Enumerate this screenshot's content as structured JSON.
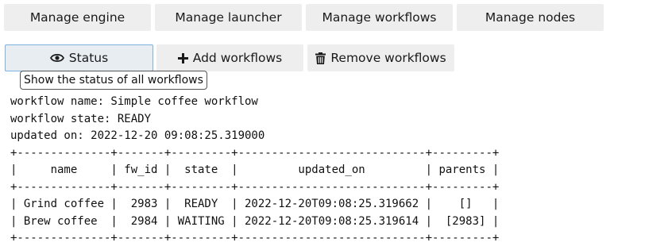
{
  "toolbar": {
    "manage_engine": "Manage engine",
    "manage_launcher": "Manage launcher",
    "manage_workflows": "Manage workflows",
    "manage_nodes": "Manage nodes"
  },
  "actions": {
    "status": {
      "label": "Status",
      "icon": "eye-icon"
    },
    "add_workflows": {
      "label": "Add workflows",
      "icon": "plus-icon"
    },
    "remove_workflows": {
      "label": "Remove workflows",
      "icon": "trash-icon"
    }
  },
  "tooltip": "Show the status of all workflows",
  "output": {
    "workflow_name_line": "workflow name: Simple coffee workflow",
    "workflow_state_line": "workflow state: READY",
    "updated_on_line": "updated on: 2022-12-20 09:08:25.319000",
    "table": {
      "border": "+--------------+-------+---------+----------------------------+---------+",
      "header": "|     name     | fw_id |  state  |         updated_on         | parents |",
      "rows": [
        "| Grind coffee |  2983 |  READY  | 2022-12-20T09:08:25.319662 |    []   |",
        "| Brew coffee  |  2984 | WAITING | 2022-12-20T09:08:25.319614 |  [2983] |"
      ]
    }
  },
  "colors": {
    "button_bg": "#eeeeee",
    "active_border": "#7fb1e0"
  }
}
